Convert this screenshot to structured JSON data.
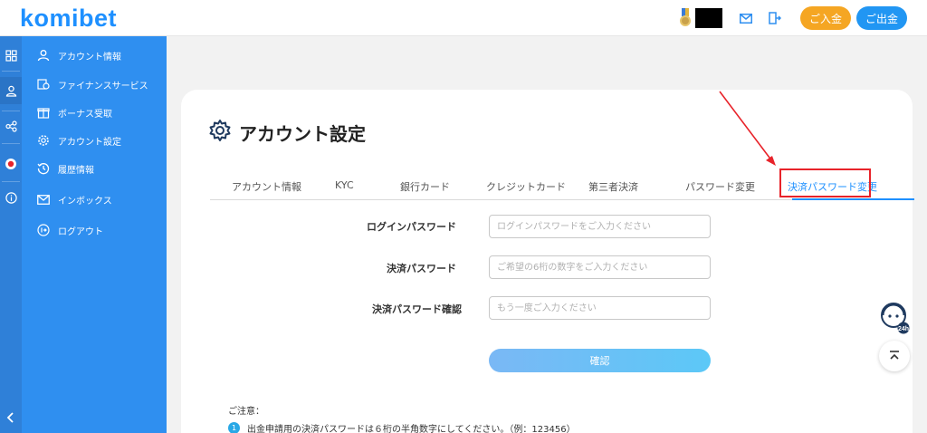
{
  "header": {
    "logo": "komibet",
    "deposit_label": "ご入金",
    "withdraw_label": "ご出金",
    "icons": [
      "medal-icon",
      "mail-icon",
      "logout-icon"
    ]
  },
  "sidebar": {
    "items": [
      {
        "label": "アカウント情報",
        "icon": "user-icon"
      },
      {
        "label": "ファイナンスサービス",
        "icon": "finance-icon"
      },
      {
        "label": "ボーナス受取",
        "icon": "bonus-icon"
      },
      {
        "label": "アカウント設定",
        "icon": "gear-icon"
      },
      {
        "label": "履歴情報",
        "icon": "history-icon"
      },
      {
        "label": "インボックス",
        "icon": "inbox-icon"
      },
      {
        "label": "ログアウト",
        "icon": "logout-icon"
      }
    ],
    "rail_icons": [
      "grid-icon",
      "user-icon",
      "share-icon",
      "record-icon",
      "info-icon",
      "collapse-chevron-icon"
    ]
  },
  "main": {
    "title": "アカウント設定",
    "tabs": [
      {
        "label": "アカウント情報"
      },
      {
        "label": "KYC"
      },
      {
        "label": "銀行カード"
      },
      {
        "label": "クレジットカード"
      },
      {
        "label": "第三者決済"
      },
      {
        "label": "パスワード変更"
      },
      {
        "label": "決済パスワード変更",
        "active": true
      }
    ],
    "form": {
      "login_password_label": "ログインパスワード",
      "login_password_placeholder": "ログインパスワードをご入力ください",
      "payment_password_label": "決済パスワード",
      "payment_password_placeholder": "ご希望の6桁の数字をご入力ください",
      "confirm_password_label": "決済パスワード確認",
      "confirm_password_placeholder": "もう一度ご入力ください",
      "submit_label": "確認"
    },
    "notes": {
      "title": "ご注意：",
      "items": [
        {
          "number": "1",
          "text": "出金申請用の決済パスワードは６桁の半角数字にしてください。（例：123456）"
        }
      ]
    }
  },
  "colors": {
    "accent": "#1e90ff",
    "sidebar": "#2f8ff0",
    "deposit": "#f5a623",
    "withdraw": "#2196f3",
    "annotation": "#e8232a"
  }
}
